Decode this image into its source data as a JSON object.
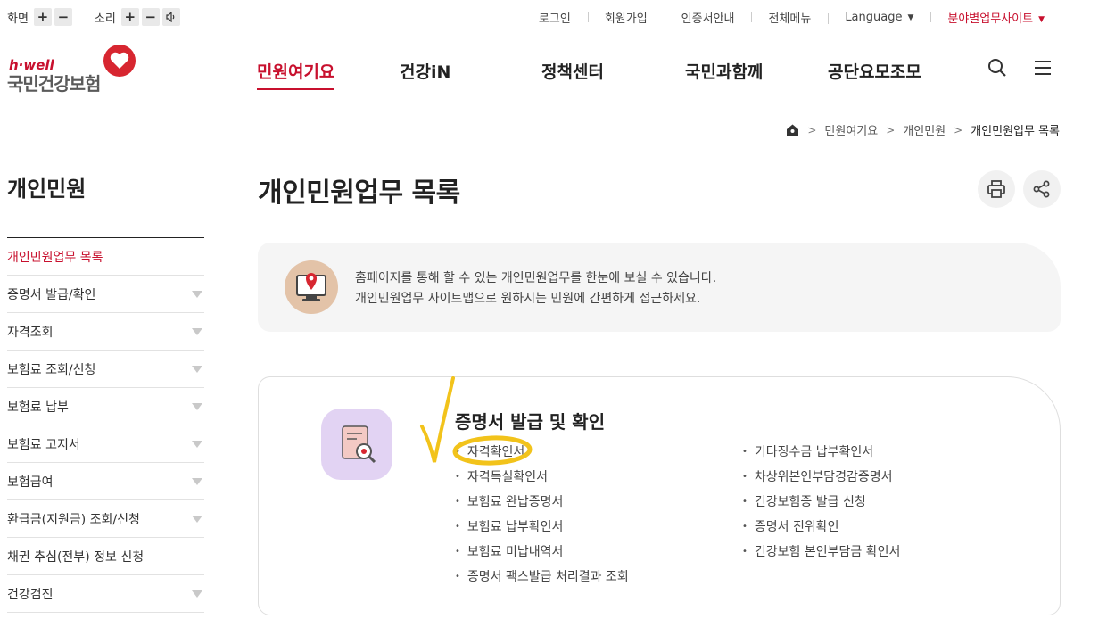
{
  "utility": {
    "screen_label": "화면",
    "sound_label": "소리",
    "plus": "+",
    "minus": "−",
    "links": [
      "로그인",
      "회원가입",
      "인증서안내",
      "전체메뉴"
    ],
    "language": "Language",
    "field_site": "분야별업무사이트"
  },
  "logo": {
    "hwell": "h·well",
    "name": "국민건강보험"
  },
  "gnb": [
    "민원여기요",
    "건강iN",
    "정책센터",
    "국민과함께",
    "공단요모조모"
  ],
  "breadcrumb": [
    "민원여기요",
    "개인민원",
    "개인민원업무 목록"
  ],
  "lnb": {
    "title": "개인민원",
    "items": [
      {
        "label": "개인민원업무 목록",
        "active": true,
        "arrow": false
      },
      {
        "label": "증명서 발급/확인",
        "arrow": true
      },
      {
        "label": "자격조회",
        "arrow": true
      },
      {
        "label": "보험료 조회/신청",
        "arrow": true
      },
      {
        "label": "보험료 납부",
        "arrow": true
      },
      {
        "label": "보험료 고지서",
        "arrow": true
      },
      {
        "label": "보험급여",
        "arrow": true
      },
      {
        "label": "환급금(지원금) 조회/신청",
        "arrow": true
      },
      {
        "label": "채권 추심(전부) 정보 신청",
        "arrow": false
      },
      {
        "label": "건강검진",
        "arrow": true
      }
    ]
  },
  "page_title": "개인민원업무 목록",
  "info": {
    "line1": "홈페이지를 통해 할 수 있는 개인민원업무를 한눈에 보실 수 있습니다.",
    "line2": "개인민원업무 사이트맵으로 원하시는 민원에 간편하게 접근하세요."
  },
  "section": {
    "title": "증명서 발급 및 확인",
    "left": [
      "자격확인서",
      "자격득실확인서",
      "보험료 완납증명서",
      "보험료 납부확인서",
      "보험료 미납내역서",
      "증명서 팩스발급 처리결과 조회"
    ],
    "right": [
      "기타징수금 납부확인서",
      "차상위본인부담경감증명서",
      "건강보험증 발급 신청",
      "증명서 진위확인",
      "건강보험 본인부담금 확인서"
    ]
  },
  "colors": {
    "accent": "#c8102e",
    "annotation": "#f2c31b"
  }
}
